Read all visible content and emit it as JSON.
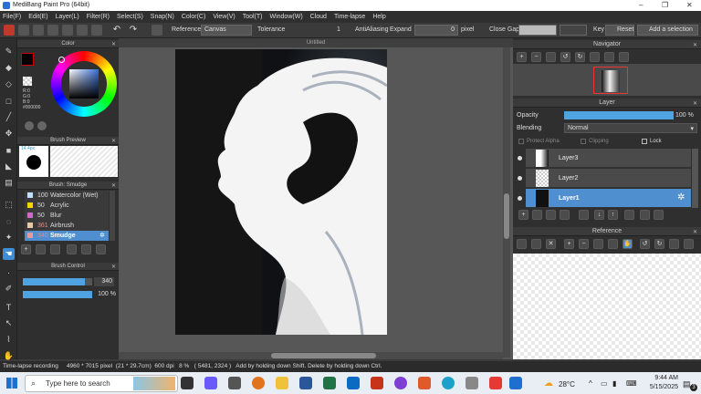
{
  "window": {
    "title": "MediBang Paint Pro (64bit)",
    "minimize": "–",
    "maximize": "❐",
    "close": "✕"
  },
  "menu": [
    "File(F)",
    "Edit(E)",
    "Layer(L)",
    "Filter(R)",
    "Select(S)",
    "Snap(N)",
    "Color(C)",
    "View(V)",
    "Tool(T)",
    "Window(W)",
    "Cloud",
    "Time-lapse",
    "Help"
  ],
  "toolbar": {
    "reference_label": "Reference",
    "reference_value": "Canvas",
    "tolerance_label": "Tolerance",
    "tolerance_value": "1",
    "antialiasing_label": "AntiAliasing",
    "expand_label": "Expand",
    "expand_value": "0",
    "expand_unit": "pixel",
    "close_gaps_label": "Close Gaps",
    "key_label": "Key",
    "reset_label": "Reset",
    "add_selection_label": "Add a selection"
  },
  "color_panel": {
    "title": "Color",
    "r": "R:0",
    "g": "G:0",
    "b": "B:0",
    "hex": "#000000",
    "primary_color": "#000000",
    "secondary_color": "#ffffff"
  },
  "brush_preview": {
    "title": "Brush Preview",
    "size": "14.4px"
  },
  "brush_panel": {
    "title": "Brush: Smudge",
    "items": [
      {
        "size": "100",
        "name": "Watercolor (Wet)",
        "swatch": "#bfe0ff"
      },
      {
        "size": "50",
        "name": "Acrylic",
        "swatch": "#f5d400"
      },
      {
        "size": "50",
        "name": "Blur",
        "swatch": "#d06ac8"
      },
      {
        "size": "361",
        "name": "Airbrush",
        "swatch": "#e8c9a0"
      },
      {
        "size": "340",
        "name": "Smudge",
        "swatch": "#e89a9a"
      }
    ]
  },
  "brush_control": {
    "title": "Brush Control",
    "size_value": "340",
    "opacity_value": "100 %",
    "size_fraction": 0.9,
    "opacity_fraction": 1.0
  },
  "canvas": {
    "tab_title": "Untitled"
  },
  "navigator": {
    "title": "Navigator"
  },
  "layer_panel": {
    "title": "Layer",
    "opacity_label": "Opacity",
    "opacity_value": "100 %",
    "opacity_fraction": 1.0,
    "blending_label": "Blending",
    "blending_value": "Normal",
    "protect_alpha_label": "Protect Alpha",
    "clipping_label": "Clipping",
    "lock_label": "Lock",
    "layers": [
      {
        "name": "Layer3",
        "selected": false
      },
      {
        "name": "Layer2",
        "selected": false
      },
      {
        "name": "Layer1",
        "selected": true
      }
    ]
  },
  "reference_panel": {
    "title": "Reference"
  },
  "status": {
    "recording": "Time-lapse recording",
    "size": "4960 * 7015 pixel",
    "physical": "(21 * 29.7cm)",
    "dpi": "600 dpi",
    "zoom": "8 %",
    "coords": "( 5481, 2324 )",
    "hint": "Add by holding down Shift. Delete by holding down Ctrl."
  },
  "taskbar": {
    "search_placeholder": "Type here to search",
    "temperature": "28°C",
    "time": "9:44 AM",
    "date": "5/15/2025",
    "notification_count": "3"
  }
}
